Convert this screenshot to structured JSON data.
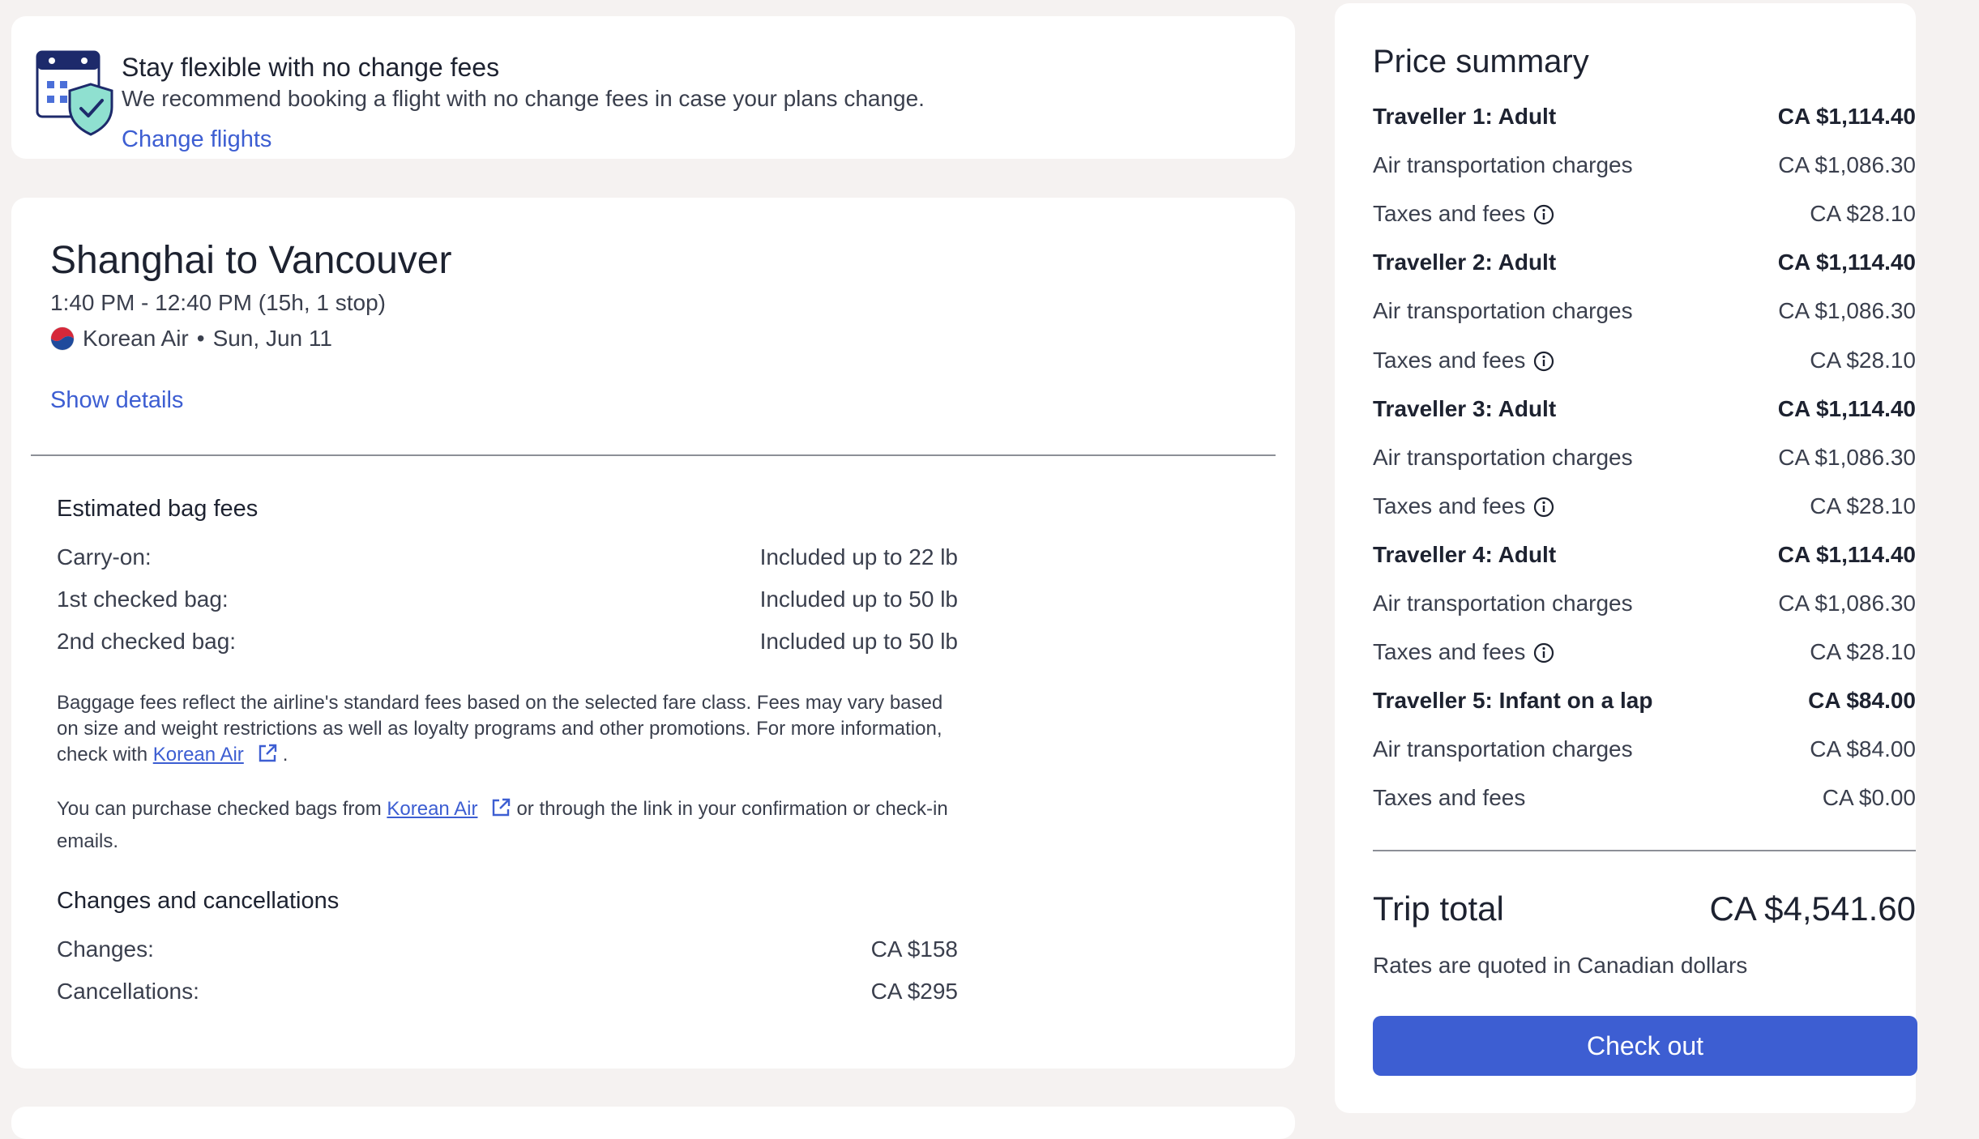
{
  "banner": {
    "title": "Stay flexible with no change fees",
    "text": "We recommend booking a flight with no change fees in case your plans change.",
    "link": "Change flights",
    "icon": "calendar-shield-icon"
  },
  "flight": {
    "title": "Shanghai to Vancouver",
    "time": "1:40 PM - 12:40 PM (15h, 1 stop)",
    "airline": "Korean Air",
    "separator": "•",
    "date": "Sun, Jun 11",
    "show_details": "Show details"
  },
  "bags": {
    "title": "Estimated bag fees",
    "rows": [
      {
        "label": "Carry-on:",
        "value": "Included up to 22 lb"
      },
      {
        "label": "1st checked bag:",
        "value": "Included up to 50 lb"
      },
      {
        "label": "2nd checked bag:",
        "value": "Included up to 50 lb"
      }
    ],
    "note1_text": "Baggage fees reflect the airline's standard fees based on the selected fare class. Fees may vary based on size and weight restrictions as well as loyalty programs and other promotions. For more information, check with",
    "note1_link": "Korean Air",
    "note1_end": ".",
    "note2_text": "You can purchase checked bags from",
    "note2_link": "Korean Air",
    "note2_end": "or through the link in your confirmation or check-in emails."
  },
  "changes": {
    "title": "Changes and cancellations",
    "rows": [
      {
        "label": "Changes:",
        "value": "CA $158"
      },
      {
        "label": "Cancellations:",
        "value": "CA $295"
      }
    ]
  },
  "summary": {
    "title": "Price summary",
    "rows": [
      {
        "label": "Traveller 1: Adult",
        "amount": "CA $1,114.40"
      },
      {
        "label": "Air transportation charges",
        "amount": "CA $1,086.30"
      },
      {
        "label": "Taxes and fees",
        "amount": "CA $28.10"
      },
      {
        "label": "Traveller 2: Adult",
        "amount": "CA $1,114.40"
      },
      {
        "label": "Air transportation charges",
        "amount": "CA $1,086.30"
      },
      {
        "label": "Taxes and fees",
        "amount": "CA $28.10"
      },
      {
        "label": "Traveller 3: Adult",
        "amount": "CA $1,114.40"
      },
      {
        "label": "Air transportation charges",
        "amount": "CA $1,086.30"
      },
      {
        "label": "Taxes and fees",
        "amount": "CA $28.10"
      },
      {
        "label": "Traveller 4: Adult",
        "amount": "CA $1,114.40"
      },
      {
        "label": "Air transportation charges",
        "amount": "CA $1,086.30"
      },
      {
        "label": "Taxes and fees",
        "amount": "CA $28.10"
      },
      {
        "label": "Traveller 5: Infant on a lap",
        "amount": "CA $84.00"
      },
      {
        "label": "Air transportation charges",
        "amount": "CA $84.00"
      },
      {
        "label": "Taxes and fees",
        "amount": "CA $0.00"
      }
    ],
    "total_label": "Trip total",
    "total_amount": "CA $4,541.60",
    "rates_note": "Rates are quoted in Canadian dollars",
    "checkout": "Check out"
  },
  "colors": {
    "accent": "#3d5ed2",
    "page_bg": "#f5f2f1",
    "text": "#1d2230"
  }
}
